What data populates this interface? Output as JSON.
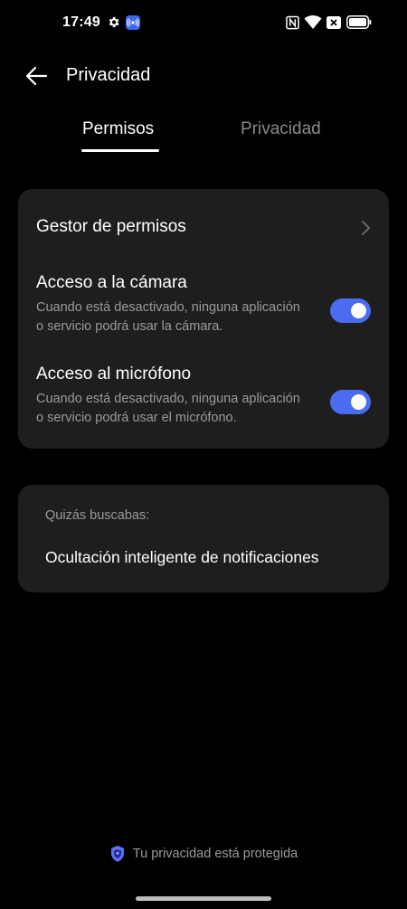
{
  "status_bar": {
    "time": "17:49",
    "icons": [
      "gear-icon",
      "cast-icon",
      "nfc-icon",
      "wifi-icon",
      "sim-off-icon",
      "battery-icon"
    ]
  },
  "header": {
    "back_icon": "arrow-left-icon",
    "title": "Privacidad"
  },
  "tabs": [
    {
      "label": "Permisos",
      "active": true
    },
    {
      "label": "Privacidad",
      "active": false
    }
  ],
  "permissions_card": {
    "manager": {
      "label": "Gestor de permisos",
      "icon": "chevron-right-icon"
    },
    "camera": {
      "title": "Acceso a la cámara",
      "desc_line1": "Cuando está desactivado, ninguna aplicación",
      "desc_line2": "o servicio podrá usar la cámara.",
      "enabled": true
    },
    "microphone": {
      "title": "Acceso al micrófono",
      "desc_line1": "Cuando está desactivado, ninguna aplicación",
      "desc_line2": "o servicio podrá usar el micrófono.",
      "enabled": true
    }
  },
  "suggestions": {
    "label": "Quizás buscabas:",
    "link": "Ocultación inteligente de notificaciones"
  },
  "footer": {
    "icon": "shield-icon",
    "text": "Tu privacidad está protegida"
  },
  "colors": {
    "background": "#000000",
    "card": "#1e1e1e",
    "accent": "#4a6cf0",
    "secondary_text": "#9a9a9a"
  }
}
